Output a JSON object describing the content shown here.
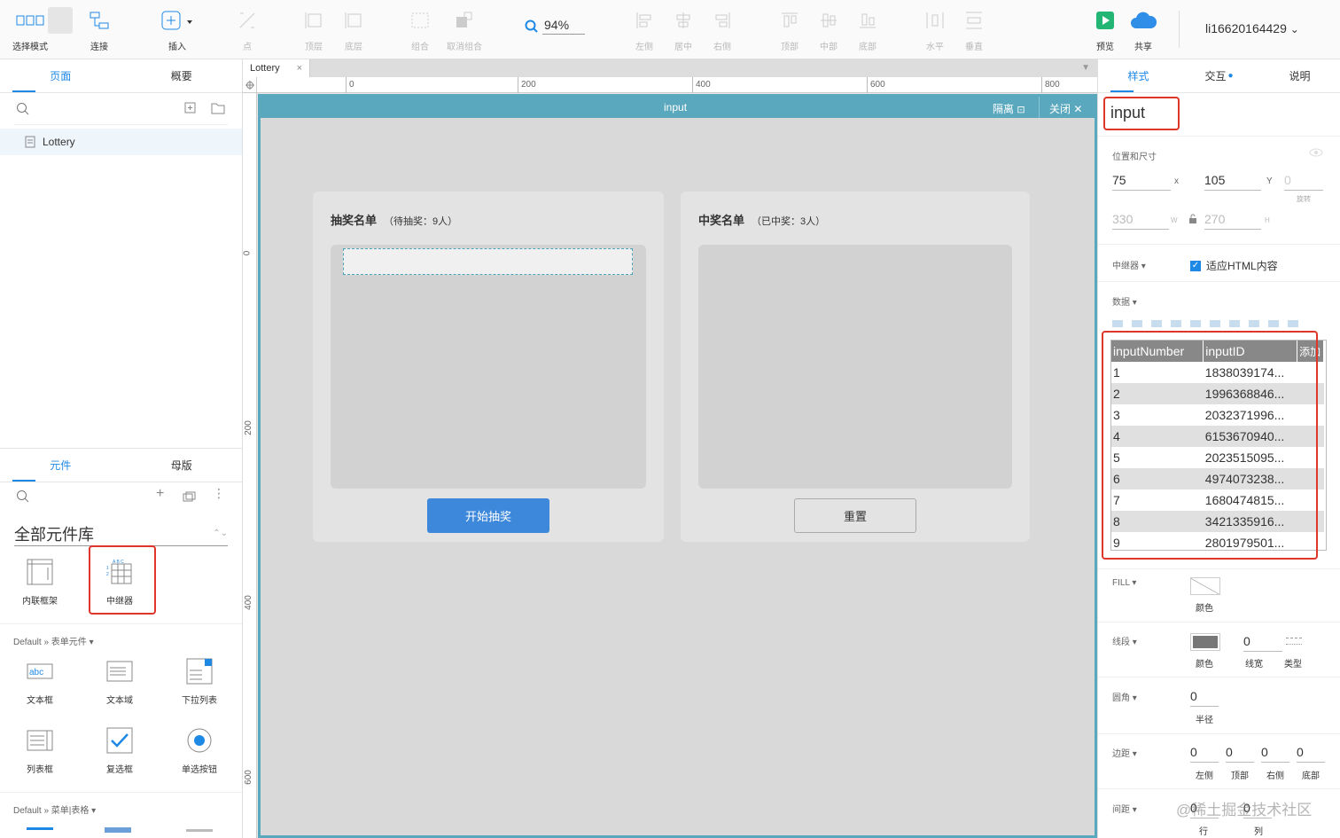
{
  "toolbar": {
    "items": [
      {
        "label": "选择模式",
        "icon": "select-mode-icon"
      },
      {
        "label": "连接",
        "icon": "connect-icon"
      },
      {
        "label": "插入",
        "icon": "insert-icon"
      },
      {
        "label": "点",
        "icon": "point-icon"
      },
      {
        "label": "顶层",
        "icon": "bring-front-icon"
      },
      {
        "label": "底层",
        "icon": "send-back-icon"
      },
      {
        "label": "组合",
        "icon": "group-icon"
      },
      {
        "label": "取消组合",
        "icon": "ungroup-icon"
      },
      {
        "label": "左侧",
        "icon": "align-left-icon"
      },
      {
        "label": "居中",
        "icon": "align-center-icon"
      },
      {
        "label": "右侧",
        "icon": "align-right-icon"
      },
      {
        "label": "顶部",
        "icon": "align-top-icon"
      },
      {
        "label": "中部",
        "icon": "align-middle-icon"
      },
      {
        "label": "底部",
        "icon": "align-bottom-icon"
      },
      {
        "label": "水平",
        "icon": "distribute-h-icon"
      },
      {
        "label": "垂直",
        "icon": "distribute-v-icon"
      },
      {
        "label": "预览",
        "icon": "preview-icon"
      },
      {
        "label": "共享",
        "icon": "share-cloud-icon"
      }
    ],
    "zoom": "94%",
    "user": "li16620164429"
  },
  "left": {
    "tabs": [
      "页面",
      "概要"
    ],
    "page": "Lottery",
    "comp_tabs": [
      "元件",
      "母版"
    ],
    "library": "全部元件库",
    "comps_top": [
      "内联框架",
      "中继器"
    ],
    "group1": "Default » 表单元件",
    "form_comps": [
      "文本框",
      "文本域",
      "下拉列表",
      "列表框",
      "复选框",
      "单选按钮"
    ],
    "group2": "Default » 菜单|表格"
  },
  "canvas": {
    "doc_tab": "Lottery",
    "ruler_h": [
      "0",
      "200",
      "400",
      "600",
      "800"
    ],
    "ruler_v": [
      "0",
      "200",
      "400",
      "600"
    ],
    "edit_title": "input",
    "isolate": "隔离",
    "close": "关闭",
    "card1_title": "抽奖名单",
    "card1_sub": "（待抽奖：9人）",
    "card2_title": "中奖名单",
    "card2_sub": "（已中奖：3人）",
    "start_btn": "开始抽奖",
    "reset_btn": "重置"
  },
  "right": {
    "tabs": [
      "样式",
      "交互",
      "说明"
    ],
    "name": "input",
    "pos_title": "位置和尺寸",
    "x": "75",
    "x_lbl": "x",
    "y": "105",
    "y_lbl": "Y",
    "rot": "0",
    "rot_lbl": "旋转",
    "w": "330",
    "w_lbl": "W",
    "h": "270",
    "h_lbl": "H",
    "repeater_lbl": "中继器",
    "fit_html": "适应HTML内容",
    "data_lbl": "数据",
    "add_col": "添加",
    "cols": [
      "inputNumber",
      "inputID"
    ],
    "rows": [
      [
        "1",
        "1838039174..."
      ],
      [
        "2",
        "1996368846..."
      ],
      [
        "3",
        "2032371996..."
      ],
      [
        "4",
        "6153670940..."
      ],
      [
        "5",
        "2023515095..."
      ],
      [
        "6",
        "4974073238..."
      ],
      [
        "7",
        "1680474815..."
      ],
      [
        "8",
        "3421335916..."
      ],
      [
        "9",
        "2801979501..."
      ]
    ],
    "fill_lbl": "FILL",
    "fill_color": "颜色",
    "stroke_lbl": "线段",
    "stroke_color": "颜色",
    "stroke_w": "0",
    "stroke_w_lbl": "线宽",
    "stroke_type": "类型",
    "radius_lbl": "圆角",
    "radius": "0",
    "radius_sub": "半径",
    "padding_lbl": "边距",
    "pad": [
      "0",
      "0",
      "0",
      "0"
    ],
    "pad_lbls": [
      "左侧",
      "顶部",
      "右侧",
      "底部"
    ],
    "spacing_lbl": "间距",
    "sp": [
      "0",
      "0"
    ],
    "sp_lbls": [
      "行",
      "列"
    ],
    "watermark": "@稀土掘金技术社区"
  },
  "colors": {
    "accent": "#1e88e5",
    "frame": "#5aa8bd",
    "highlight": "#e0352b"
  }
}
